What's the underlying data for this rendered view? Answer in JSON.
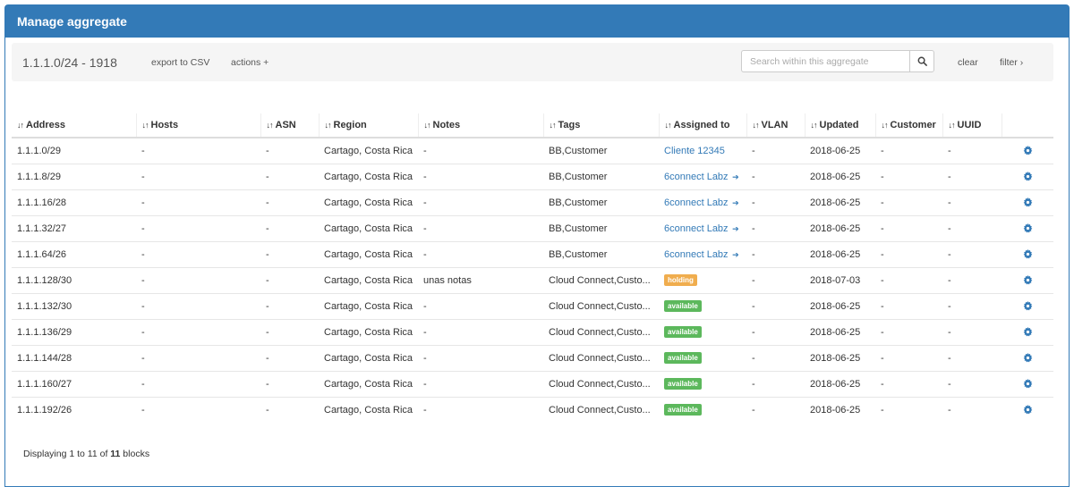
{
  "panel": {
    "title": "Manage aggregate"
  },
  "toolbar": {
    "aggregate": "1.1.1.0/24 - 1918",
    "export_label": "export to CSV",
    "actions_label": "actions +",
    "search_placeholder": "Search within this aggregate",
    "search_icon": "search-icon",
    "clear_label": "clear",
    "filter_label": "filter"
  },
  "table": {
    "columns": [
      "Address",
      "Hosts",
      "ASN",
      "Region",
      "Notes",
      "Tags",
      "Assigned to",
      "VLAN",
      "Updated",
      "Customer",
      "UUID"
    ],
    "rows": [
      {
        "address": "1.1.1.0/29",
        "hosts": "-",
        "asn": "-",
        "region": "Cartago, Costa Rica",
        "notes": "-",
        "tags": "BB,Customer",
        "assigned": "Cliente 12345",
        "assigned_type": "link",
        "arrow": false,
        "vlan": "-",
        "updated": "2018-06-25",
        "customer": "-",
        "uuid": "-"
      },
      {
        "address": "1.1.1.8/29",
        "hosts": "-",
        "asn": "-",
        "region": "Cartago, Costa Rica",
        "notes": "-",
        "tags": "BB,Customer",
        "assigned": "6connect Labz",
        "assigned_type": "link",
        "arrow": true,
        "vlan": "-",
        "updated": "2018-06-25",
        "customer": "-",
        "uuid": "-"
      },
      {
        "address": "1.1.1.16/28",
        "hosts": "-",
        "asn": "-",
        "region": "Cartago, Costa Rica",
        "notes": "-",
        "tags": "BB,Customer",
        "assigned": "6connect Labz",
        "assigned_type": "link",
        "arrow": true,
        "vlan": "-",
        "updated": "2018-06-25",
        "customer": "-",
        "uuid": "-"
      },
      {
        "address": "1.1.1.32/27",
        "hosts": "-",
        "asn": "-",
        "region": "Cartago, Costa Rica",
        "notes": "-",
        "tags": "BB,Customer",
        "assigned": "6connect Labz",
        "assigned_type": "link",
        "arrow": true,
        "vlan": "-",
        "updated": "2018-06-25",
        "customer": "-",
        "uuid": "-"
      },
      {
        "address": "1.1.1.64/26",
        "hosts": "-",
        "asn": "-",
        "region": "Cartago, Costa Rica",
        "notes": "-",
        "tags": "BB,Customer",
        "assigned": "6connect Labz",
        "assigned_type": "link",
        "arrow": true,
        "vlan": "-",
        "updated": "2018-06-25",
        "customer": "-",
        "uuid": "-"
      },
      {
        "address": "1.1.1.128/30",
        "hosts": "-",
        "asn": "-",
        "region": "Cartago, Costa Rica",
        "notes": "unas notas",
        "tags": "Cloud Connect,Custo...",
        "assigned": "holding",
        "assigned_type": "holding",
        "arrow": false,
        "vlan": "-",
        "updated": "2018-07-03",
        "customer": "-",
        "uuid": "-"
      },
      {
        "address": "1.1.1.132/30",
        "hosts": "-",
        "asn": "-",
        "region": "Cartago, Costa Rica",
        "notes": "-",
        "tags": "Cloud Connect,Custo...",
        "assigned": "available",
        "assigned_type": "available",
        "arrow": false,
        "vlan": "-",
        "updated": "2018-06-25",
        "customer": "-",
        "uuid": "-"
      },
      {
        "address": "1.1.1.136/29",
        "hosts": "-",
        "asn": "-",
        "region": "Cartago, Costa Rica",
        "notes": "-",
        "tags": "Cloud Connect,Custo...",
        "assigned": "available",
        "assigned_type": "available",
        "arrow": false,
        "vlan": "-",
        "updated": "2018-06-25",
        "customer": "-",
        "uuid": "-"
      },
      {
        "address": "1.1.1.144/28",
        "hosts": "-",
        "asn": "-",
        "region": "Cartago, Costa Rica",
        "notes": "-",
        "tags": "Cloud Connect,Custo...",
        "assigned": "available",
        "assigned_type": "available",
        "arrow": false,
        "vlan": "-",
        "updated": "2018-06-25",
        "customer": "-",
        "uuid": "-"
      },
      {
        "address": "1.1.1.160/27",
        "hosts": "-",
        "asn": "-",
        "region": "Cartago, Costa Rica",
        "notes": "-",
        "tags": "Cloud Connect,Custo...",
        "assigned": "available",
        "assigned_type": "available",
        "arrow": false,
        "vlan": "-",
        "updated": "2018-06-25",
        "customer": "-",
        "uuid": "-"
      },
      {
        "address": "1.1.1.192/26",
        "hosts": "-",
        "asn": "-",
        "region": "Cartago, Costa Rica",
        "notes": "-",
        "tags": "Cloud Connect,Custo...",
        "assigned": "available",
        "assigned_type": "available",
        "arrow": false,
        "vlan": "-",
        "updated": "2018-06-25",
        "customer": "-",
        "uuid": "-"
      }
    ],
    "row_action_icon": "gear-icon"
  },
  "footer": {
    "prefix": "Displaying 1 to 11 of ",
    "total": "11",
    "suffix": " blocks"
  },
  "colors": {
    "primary": "#337ab7",
    "holding": "#f0ad4e",
    "available": "#5cb85c"
  }
}
